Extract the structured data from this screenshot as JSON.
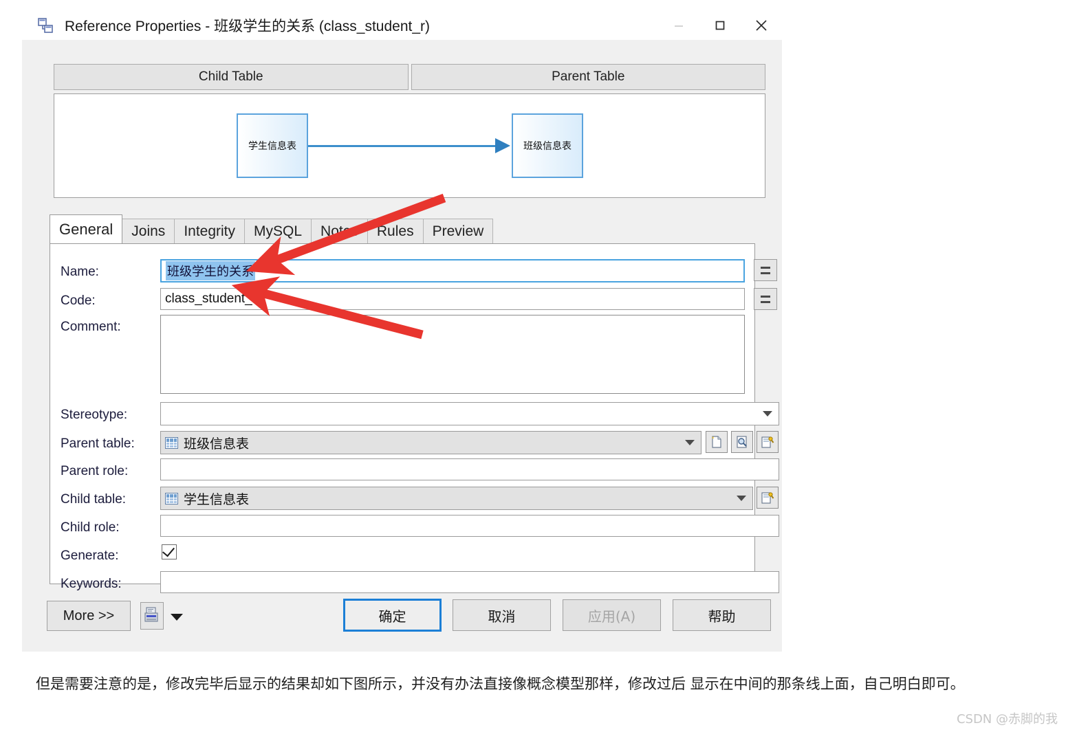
{
  "window": {
    "title": "Reference Properties - 班级学生的关系 (class_student_r)",
    "icon": "reference-icon",
    "minimize_label": "—",
    "maximize_label": "□",
    "close_label": "✕"
  },
  "diagram": {
    "child_header": "Child Table",
    "parent_header": "Parent Table",
    "child_box_label": "学生信息表",
    "parent_box_label": "班级信息表",
    "link_direction": "child-to-parent"
  },
  "tabs": [
    {
      "label": "General",
      "active": true
    },
    {
      "label": "Joins",
      "active": false
    },
    {
      "label": "Integrity",
      "active": false
    },
    {
      "label": "MySQL",
      "active": false
    },
    {
      "label": "Notes",
      "active": false
    },
    {
      "label": "Rules",
      "active": false
    },
    {
      "label": "Preview",
      "active": false
    }
  ],
  "form": {
    "name": {
      "label": "Name:",
      "value": "班级学生的关系",
      "selected": true,
      "focused": true
    },
    "code": {
      "label": "Code:",
      "value": "class_student_r"
    },
    "comment": {
      "label": "Comment:",
      "value": ""
    },
    "stereotype": {
      "label": "Stereotype:",
      "value": ""
    },
    "parent_table": {
      "label": "Parent table:",
      "value": "班级信息表",
      "icon": "table-icon"
    },
    "parent_role": {
      "label": "Parent role:",
      "value": ""
    },
    "child_table": {
      "label": "Child table:",
      "value": "学生信息表",
      "icon": "table-icon"
    },
    "child_role": {
      "label": "Child role:",
      "value": ""
    },
    "generate": {
      "label": "Generate:",
      "checked": true
    },
    "keywords": {
      "label": "Keywords:",
      "value": ""
    },
    "equals_button_label": "=",
    "side_buttons": [
      "create-object-icon",
      "browse-object-icon",
      "properties-object-icon"
    ],
    "child_side_buttons": [
      "properties-object-icon"
    ]
  },
  "buttons": {
    "more": "More >>",
    "report": "report-icon",
    "report_dropdown": "chevron-down-icon",
    "ok": "确定",
    "cancel": "取消",
    "apply": "应用(A)",
    "apply_disabled": true,
    "help": "帮助"
  },
  "caption": {
    "text": "但是需要注意的是，修改完毕后显示的结果却如下图所示，并没有办法直接像概念模型那样，修改过后 显示在中间的那条线上面，自己明白即可。"
  },
  "watermark": {
    "text": "CSDN @赤脚的我"
  },
  "annotations": {
    "arrow1_target": "name-field",
    "arrow2_target": "code-field",
    "color": "#e8352e"
  },
  "colors": {
    "accent": "#1c7fd6",
    "selection": "#8fc4ef",
    "diagram_box_border": "#5ba3dd",
    "annotation_red": "#e8352e"
  }
}
